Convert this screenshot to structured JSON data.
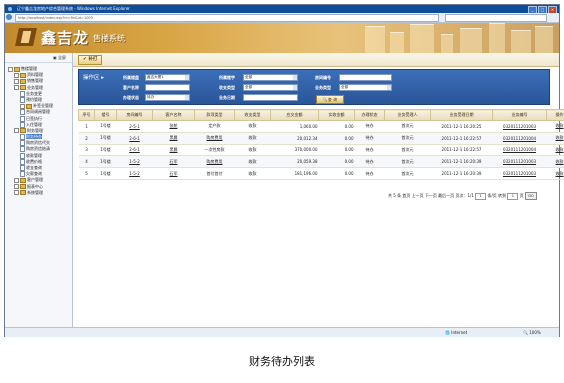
{
  "window": {
    "title": "辽宁鑫吉龙房地产综合管理系统 - Windows Internet Explorer",
    "address": "http://localhost/index.asp?m=fin&id=1003"
  },
  "header": {
    "logo": "鑫吉龙",
    "subtitle": "售楼系统"
  },
  "sidebar": {
    "top_label": "全屏",
    "items": [
      {
        "label": "售楼管理",
        "indent": 0,
        "type": "root"
      },
      {
        "label": "资料管理",
        "indent": 1,
        "type": "folder"
      },
      {
        "label": "销售管理",
        "indent": 1,
        "type": "folder"
      },
      {
        "label": "业务管理",
        "indent": 1,
        "type": "folder"
      },
      {
        "label": "业务变更",
        "indent": 2,
        "type": "page"
      },
      {
        "label": "预约管理",
        "indent": 2,
        "type": "page"
      },
      {
        "label": "补签业管理",
        "indent": 2,
        "type": "folder"
      },
      {
        "label": "合同调阅管理",
        "indent": 2,
        "type": "page"
      },
      {
        "label": "已签执行",
        "indent": 2,
        "type": "page"
      },
      {
        "label": "入住管理",
        "indent": 2,
        "type": "page"
      },
      {
        "label": "财务管理",
        "indent": 1,
        "type": "folder"
      },
      {
        "label": "财务待办",
        "indent": 2,
        "type": "page",
        "selected": true
      },
      {
        "label": "购房资信代交",
        "indent": 2,
        "type": "page"
      },
      {
        "label": "购房资信结清",
        "indent": 2,
        "type": "page"
      },
      {
        "label": "收款管理",
        "indent": 2,
        "type": "page"
      },
      {
        "label": "收费价格",
        "indent": 2,
        "type": "page"
      },
      {
        "label": "收支查询",
        "indent": 2,
        "type": "page"
      },
      {
        "label": "欠款查询",
        "indent": 2,
        "type": "page"
      },
      {
        "label": "客户管理",
        "indent": 1,
        "type": "folder"
      },
      {
        "label": "报表中心",
        "indent": 1,
        "type": "folder"
      },
      {
        "label": "系统管理",
        "indent": 1,
        "type": "folder"
      }
    ]
  },
  "toolbar": {
    "add_label": "✔ 补打"
  },
  "search": {
    "ops_label": "操作区",
    "project_label": "所属楼盘",
    "project_value": "鑫吉大厦1",
    "building_label": "所属楼宇",
    "building_value": "全部",
    "room_label": "房间编号",
    "room_value": "",
    "customer_label": "客户名称",
    "customer_value": "",
    "fee_label": "收支类型",
    "fee_value": "全部",
    "biztype_label": "业务类型",
    "biztype_value": "全部",
    "status_label": "办理状态",
    "status_value": "待办",
    "date_label": "业务日期",
    "date_value": "",
    "query_label": "查 询"
  },
  "table": {
    "headers": [
      "序号",
      "楼号",
      "房间编号",
      "客户名称",
      "款项类型",
      "收支类型",
      "应交金额",
      "实收金额",
      "办理状态",
      "业务受理人",
      "业务受理日期",
      "业务编号",
      "操作"
    ],
    "rows": [
      {
        "no": "1",
        "bld": "1号楼",
        "room": "2-5-1",
        "cust": "张航",
        "item": "定产款",
        "dir": "收款",
        "due": "1,060.00",
        "paid": "0.00",
        "status": "待办",
        "by": "首次元",
        "date": "2011-12-1 16:20:25",
        "code": "0320111201003",
        "op": "收款"
      },
      {
        "no": "2",
        "bld": "1号楼",
        "room": "2-6-1",
        "cust": "黑晨",
        "item": "购房费用",
        "dir": "收款",
        "due": "20,012.34",
        "paid": "0.00",
        "status": "待办",
        "by": "首次元",
        "date": "2011-12-1 16:22:57",
        "code": "0320111201004",
        "op": "收款"
      },
      {
        "no": "3",
        "bld": "1号楼",
        "room": "2-6-1",
        "cust": "黑晨",
        "item": "一次性房款",
        "dir": "收款",
        "due": "370,000.00",
        "paid": "0.00",
        "status": "待办",
        "by": "首次元",
        "date": "2011-12-1 16:22:57",
        "code": "0320111201004",
        "op": "收款"
      },
      {
        "no": "4",
        "bld": "1号楼",
        "room": "1-5-2",
        "cust": "石军",
        "item": "购房费用",
        "dir": "收款",
        "due": "20,059.38",
        "paid": "0.00",
        "status": "待办",
        "by": "首次元",
        "date": "2011-12-1 16:20:39",
        "code": "0320111201003",
        "op": "收款"
      },
      {
        "no": "5",
        "bld": "1号楼",
        "room": "1-5-2",
        "cust": "石军",
        "item": "首付首付",
        "dir": "收款",
        "due": "181,196.00",
        "paid": "0.00",
        "status": "待办",
        "by": "首次元",
        "date": "2011-12-1 16:20:39",
        "code": "0320111201003",
        "op": "收款"
      }
    ]
  },
  "pager": {
    "text": "共 5 条  首页  上一页  下一页  最后一页  页次：1/1",
    "page": "1",
    "per_label": "条/页 转到",
    "goto": "1",
    "page_label": "页",
    "go_label": "GO"
  },
  "status": {
    "zone": "Internet",
    "zoom": "100%"
  },
  "caption": "财务待办列表"
}
